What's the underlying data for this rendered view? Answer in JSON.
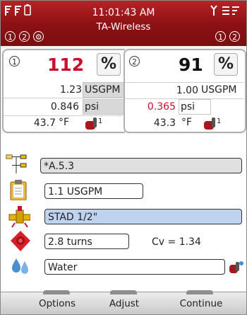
{
  "status": {
    "time": "11:01:43 AM",
    "network": "TA-Wireless",
    "left_channels": [
      "1",
      "2"
    ],
    "right_channels": [
      "1",
      "2"
    ]
  },
  "left": {
    "channel": "1",
    "percent_value": "112",
    "percent_unit": "%",
    "flow_value": "1.23",
    "flow_unit": "USGPM",
    "pressure_value": "0.846",
    "pressure_unit": "psi",
    "temp_value": "43.7",
    "temp_unit": "°F",
    "sensor_channel": "1"
  },
  "right": {
    "channel": "2",
    "percent_value": "91",
    "percent_unit": "%",
    "flow_value": "1.00",
    "flow_unit": "USGPM",
    "pressure_value": "0.365",
    "pressure_unit": "psi",
    "temp_value": "43.3",
    "temp_unit": "°F",
    "sensor_channel": "1"
  },
  "list": {
    "circuit": "*A.5.3",
    "design_flow": "1.1 USGPM",
    "valve": "STAD 1/2\"",
    "turns": "2.8 turns",
    "cv": "Cv = 1.34",
    "medium": "Water"
  },
  "softkeys": {
    "options": "Options",
    "adjust": "Adjust",
    "continue": "Continue"
  },
  "colors": {
    "header": "#8b1114",
    "alert_red": "#c8102e",
    "selected_blue": "#bfd3ef"
  }
}
